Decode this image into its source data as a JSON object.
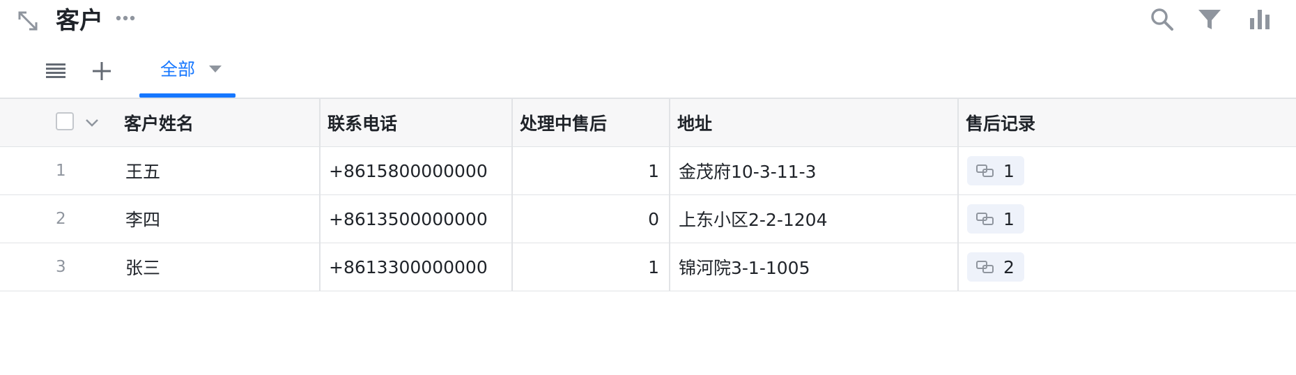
{
  "header": {
    "title": "客户",
    "icons": [
      "expand-icon",
      "more-icon",
      "search-icon",
      "filter-icon",
      "chart-icon"
    ]
  },
  "tabs": {
    "all_label": "全部"
  },
  "table": {
    "columns": [
      "客户姓名",
      "联系电话",
      "处理中售后",
      "地址",
      "售后记录"
    ],
    "rows": [
      {
        "index": "1",
        "name": "王五",
        "phone": "+8615800000000",
        "pending": "1",
        "address": "金茂府10-3-11-3",
        "records": "1"
      },
      {
        "index": "2",
        "name": "李四",
        "phone": "+8613500000000",
        "pending": "0",
        "address": "上东小区2-2-1204",
        "records": "1"
      },
      {
        "index": "3",
        "name": "张三",
        "phone": "+8613300000000",
        "pending": "1",
        "address": "锦河院3-1-1005",
        "records": "2"
      }
    ]
  },
  "colors": {
    "accent": "#1677ff",
    "icon_gray": "#8f959e",
    "border": "#e1e3e6",
    "header_bg": "#f7f7f8",
    "chip_bg": "#eef2fa"
  }
}
